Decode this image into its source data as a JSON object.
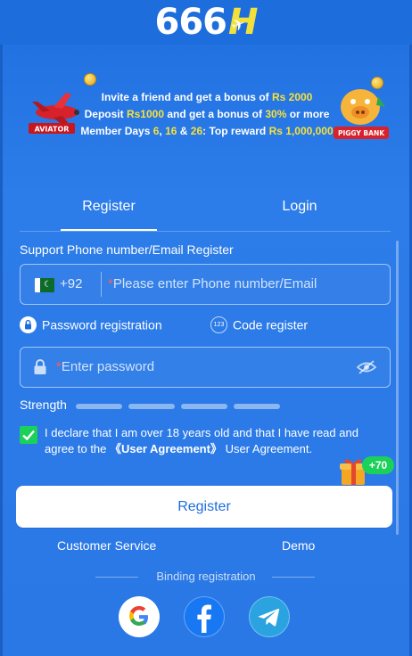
{
  "brand": {
    "logo_digits": "666",
    "logo_letter": "H"
  },
  "banner": {
    "line1_a": "Invite a friend and get a bonus of ",
    "line1_b": "Rs 2000",
    "line2_a": "Deposit ",
    "line2_b": "Rs1000",
    "line2_c": " and get a bonus of ",
    "line2_d": "30%",
    "line2_e": " or more",
    "line3_a": "Member Days ",
    "line3_b": "6",
    "line3_c": ", ",
    "line3_d": "16",
    "line3_e": " & ",
    "line3_f": "26",
    "line3_g": ": Top reward ",
    "line3_h": "Rs 1,000,000",
    "left_game": "AVIATOR",
    "right_game": "PIGGY BANK"
  },
  "tabs": [
    {
      "label": "Register",
      "active": true
    },
    {
      "label": "Login",
      "active": false
    }
  ],
  "form": {
    "section_label": "Support Phone number/Email Register",
    "country_code": "+92",
    "required_mark": "*",
    "phone_placeholder": "Please enter Phone number/Email",
    "mode_password_label": "Password registration",
    "mode_code_label": "Code register",
    "mode_code_icon_text": "123",
    "password_placeholder": "Enter password",
    "strength_label": "Strength",
    "strength_level": 0,
    "agreement_text_a": "I declare that I am over 18 years old and that I have read and agree to the ",
    "agreement_link": "《User Agreement》",
    "agreement_text_b": " User Agreement.",
    "agreement_checked": true,
    "submit_label": "Register",
    "reward_badge": "+70"
  },
  "footer": {
    "customer_service": "Customer Service",
    "demo": "Demo",
    "binding_label": "Binding registration"
  },
  "colors": {
    "background": "#2c7ce9",
    "accent_yellow": "#f7e13b",
    "check_green": "#1bd15a",
    "required_red": "#ff5a5a"
  },
  "icons": [
    "pakistan-flag-icon",
    "lock-icon",
    "eye-off-icon",
    "google-icon",
    "facebook-icon",
    "telegram-icon",
    "gift-icon"
  ]
}
